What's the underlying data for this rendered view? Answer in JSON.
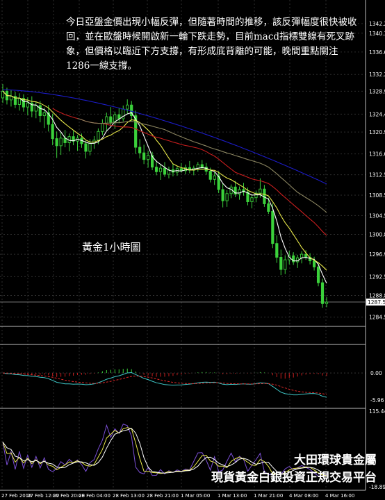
{
  "commentary": "今日亞盤金價出現小幅反彈，但隨著時間的推移，該反彈幅度很快被收回，並在歐盤時候開啟新一輪下跌走勢，目前macd指標雙線有死叉跡象，但價格以臨近下方支撐，有形成底背離的可能，晚間重點關注1286一線支撐。",
  "panel_label": "黃金1小時圖",
  "brand": {
    "line1": "大田環球貴金屬",
    "line2": "現貨黃金白銀投資正規交易平台"
  },
  "colors": {
    "background": "#000000",
    "grid": "#2e2e2e",
    "text": "#ffffff",
    "candle": "#3bd13b",
    "ma_fast": "#ffffff",
    "ma_mid": "#e8e84a",
    "ma_red": "#c81e1e",
    "ma_tan": "#8a8460",
    "ma_blue": "#1c1cc8",
    "macd_hist": "#c81e1e",
    "macd_hist_pos": "#3bd13b",
    "macd_signal": "#e02a2a",
    "macd_line": "#3fc8c8"
  },
  "chart_data": {
    "type": "candlestick",
    "price": {
      "ylim": [
        1283.0,
        1346.0
      ],
      "y_ticks": [
        "1342.20",
        "1340.30",
        "1336.60",
        "1332.20",
        "1328.90",
        "1324.40",
        "1320.90",
        "1316.60",
        "1312.50",
        "1308.50",
        "1304.50",
        "1300.80",
        "1296.90",
        "1292.50",
        "1288.80",
        "1284.55"
      ],
      "last_price": "1287.51",
      "ohlc": [
        [
          1327.6,
          1330.3,
          1326.6,
          1328.9
        ],
        [
          1328.9,
          1329.6,
          1326.3,
          1327.2
        ],
        [
          1327.2,
          1329.1,
          1325.9,
          1327.9
        ],
        [
          1327.9,
          1328.8,
          1325.6,
          1326.3
        ],
        [
          1326.3,
          1328.5,
          1325.1,
          1327.5
        ],
        [
          1327.5,
          1328.3,
          1324.9,
          1325.8
        ],
        [
          1325.8,
          1327.7,
          1324.2,
          1326.6
        ],
        [
          1326.6,
          1327.9,
          1323.8,
          1325.0
        ],
        [
          1325.0,
          1326.9,
          1323.6,
          1326.1
        ],
        [
          1326.1,
          1327.0,
          1322.8,
          1324.1
        ],
        [
          1324.1,
          1325.7,
          1321.7,
          1324.7
        ],
        [
          1324.7,
          1326.2,
          1321.0,
          1322.4
        ],
        [
          1322.4,
          1324.5,
          1318.3,
          1319.6
        ],
        [
          1319.6,
          1321.0,
          1315.8,
          1318.2
        ],
        [
          1318.2,
          1320.8,
          1316.4,
          1319.7
        ],
        [
          1319.7,
          1321.3,
          1317.9,
          1318.8
        ],
        [
          1318.8,
          1320.6,
          1317.1,
          1320.0
        ],
        [
          1320.0,
          1321.1,
          1318.3,
          1319.1
        ],
        [
          1319.1,
          1320.3,
          1317.2,
          1319.7
        ],
        [
          1319.7,
          1320.6,
          1317.8,
          1318.6
        ],
        [
          1318.6,
          1319.2,
          1315.7,
          1317.1
        ],
        [
          1317.1,
          1319.5,
          1316.3,
          1318.7
        ],
        [
          1318.7,
          1320.1,
          1317.6,
          1319.3
        ],
        [
          1319.3,
          1321.6,
          1318.5,
          1321.0
        ],
        [
          1321.0,
          1323.4,
          1320.3,
          1322.6
        ],
        [
          1322.6,
          1324.7,
          1321.2,
          1323.9
        ],
        [
          1323.9,
          1325.8,
          1322.1,
          1322.8
        ],
        [
          1322.8,
          1324.9,
          1321.5,
          1324.3
        ],
        [
          1324.3,
          1325.6,
          1322.6,
          1323.5
        ],
        [
          1323.5,
          1326.1,
          1323.0,
          1325.4
        ],
        [
          1325.4,
          1327.3,
          1324.4,
          1326.2
        ],
        [
          1326.2,
          1327.0,
          1323.1,
          1324.1
        ],
        [
          1324.1,
          1325.1,
          1316.6,
          1317.9
        ],
        [
          1317.9,
          1319.5,
          1315.7,
          1316.8
        ],
        [
          1316.8,
          1318.4,
          1314.6,
          1315.5
        ],
        [
          1315.5,
          1317.2,
          1313.9,
          1316.3
        ],
        [
          1316.3,
          1317.0,
          1313.4,
          1314.0
        ],
        [
          1314.0,
          1315.3,
          1312.4,
          1313.1
        ],
        [
          1313.1,
          1314.5,
          1311.5,
          1313.8
        ],
        [
          1313.8,
          1315.0,
          1312.1,
          1312.6
        ],
        [
          1312.6,
          1314.1,
          1311.8,
          1313.5
        ],
        [
          1313.5,
          1314.6,
          1312.2,
          1313.0
        ],
        [
          1313.0,
          1314.2,
          1312.3,
          1313.7
        ],
        [
          1313.7,
          1314.8,
          1312.9,
          1313.3
        ],
        [
          1313.3,
          1314.5,
          1312.6,
          1313.9
        ],
        [
          1313.9,
          1315.2,
          1312.8,
          1313.4
        ],
        [
          1313.4,
          1314.3,
          1312.4,
          1313.8
        ],
        [
          1313.8,
          1315.0,
          1313.1,
          1314.5
        ],
        [
          1314.5,
          1315.4,
          1313.6,
          1314.0
        ],
        [
          1314.0,
          1314.8,
          1312.5,
          1313.2
        ],
        [
          1313.2,
          1313.9,
          1311.0,
          1311.6
        ],
        [
          1311.6,
          1313.0,
          1310.5,
          1312.3
        ],
        [
          1312.3,
          1313.2,
          1308.9,
          1309.6
        ],
        [
          1309.6,
          1310.8,
          1306.1,
          1307.4
        ],
        [
          1307.4,
          1309.5,
          1306.2,
          1308.8
        ],
        [
          1308.8,
          1310.6,
          1307.9,
          1310.1
        ],
        [
          1310.1,
          1311.3,
          1308.1,
          1308.7
        ],
        [
          1308.7,
          1310.2,
          1307.6,
          1309.6
        ],
        [
          1309.6,
          1310.9,
          1308.4,
          1309.1
        ],
        [
          1309.1,
          1310.0,
          1306.5,
          1307.2
        ],
        [
          1307.2,
          1308.6,
          1305.9,
          1308.0
        ],
        [
          1308.0,
          1309.4,
          1307.1,
          1308.9
        ],
        [
          1308.9,
          1311.8,
          1308.0,
          1309.7
        ],
        [
          1309.7,
          1310.5,
          1306.2,
          1306.8
        ],
        [
          1306.8,
          1308.0,
          1304.8,
          1305.3
        ],
        [
          1305.3,
          1306.9,
          1298.1,
          1299.0
        ],
        [
          1299.0,
          1300.6,
          1295.2,
          1296.3
        ],
        [
          1296.3,
          1297.8,
          1292.8,
          1293.9
        ],
        [
          1293.9,
          1296.7,
          1293.0,
          1295.8
        ],
        [
          1295.8,
          1297.6,
          1294.9,
          1296.6
        ],
        [
          1296.6,
          1297.3,
          1294.8,
          1295.4
        ],
        [
          1295.4,
          1296.8,
          1294.2,
          1296.2
        ],
        [
          1296.2,
          1297.5,
          1295.1,
          1296.9
        ],
        [
          1296.9,
          1297.7,
          1295.8,
          1296.3
        ],
        [
          1296.3,
          1297.1,
          1294.9,
          1295.6
        ],
        [
          1295.6,
          1296.4,
          1293.7,
          1294.4
        ],
        [
          1294.4,
          1295.1,
          1290.6,
          1291.3
        ],
        [
          1291.3,
          1292.1,
          1286.4,
          1287.2
        ],
        [
          1287.2,
          1288.5,
          1286.5,
          1287.5
        ]
      ]
    },
    "macd": {
      "ylim": [
        -7.5,
        6.0
      ],
      "y_ticks": [
        "0.00",
        "-5.96"
      ]
    },
    "oscillator": {
      "ylim": [
        -20.0,
        118.0
      ],
      "y_ticks": [
        "115.44",
        "-18.897"
      ]
    },
    "x_ticks": [
      "27 Feb 2016",
      "27 Feb 12:00",
      "27 Feb 20:00",
      "28 Feb 04:00",
      "28 Feb 13:00",
      "28 Feb 21:00",
      "1 Mar 05:00",
      "1 Mar 13:00",
      "1 Mar 21:00",
      "4 Mar 08:00",
      "4 Mar 16:00"
    ]
  }
}
